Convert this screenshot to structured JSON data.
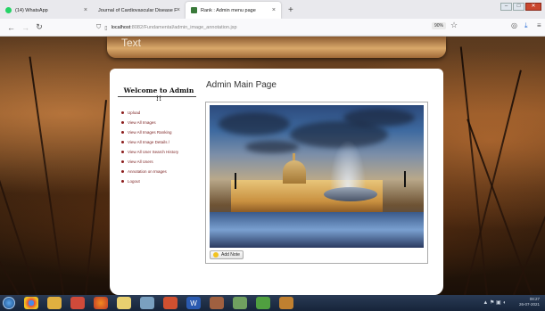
{
  "browser": {
    "tabs": [
      {
        "label": "(14) WhatsApp",
        "icon": "whatsapp-icon",
        "icon_color": "#25d366",
        "active": false
      },
      {
        "label": "Journal of Cardiovascular Disease F",
        "icon": "journal-icon",
        "active": false
      },
      {
        "label": "Rank : Admin menu page",
        "icon": "page-icon",
        "icon_color": "#3a7a3a",
        "active": true
      }
    ],
    "new_tab": "+",
    "url_host": "localhost",
    "url_path": ":8082/Fundamental/admin_image_annotation.jsp",
    "zoom": "90%"
  },
  "header": {
    "banner_text": "Text"
  },
  "sidebar": {
    "title": "Welcome to Admin !!",
    "items": [
      "Upload",
      "View All Images",
      "View All Images Ranking",
      "View All Image Details /",
      "View All User Search History",
      "View All Users",
      "Annotation on Images",
      "Logout"
    ]
  },
  "main": {
    "title": "Admin Main Page",
    "add_note_label": "Add Note"
  },
  "taskbar": {
    "time": "08:27",
    "date": "26-07-2021"
  }
}
